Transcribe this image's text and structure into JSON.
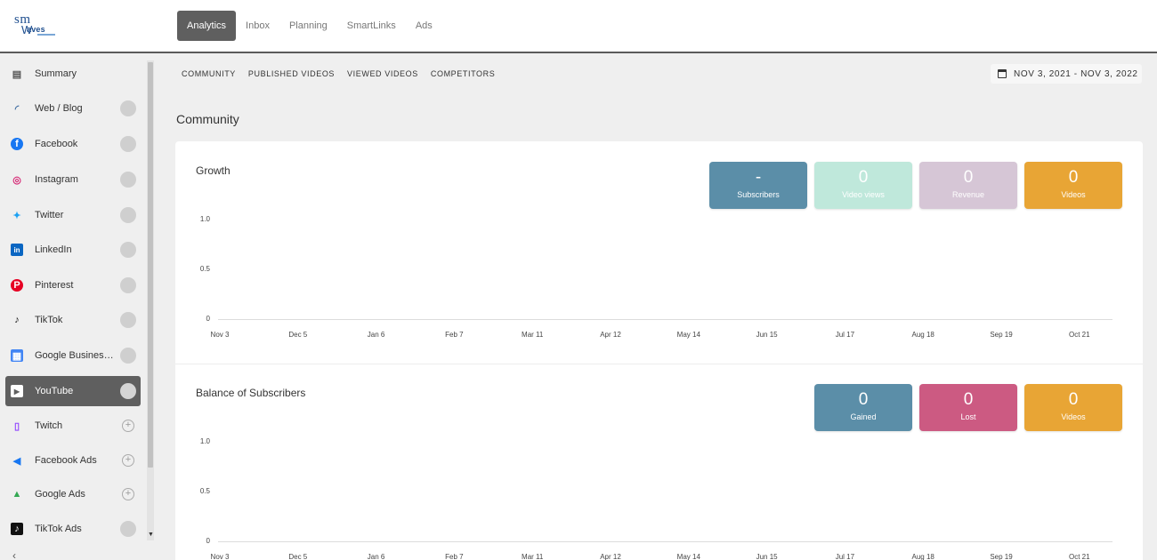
{
  "logo": {
    "text_top": "sm",
    "text_bottom": "aves"
  },
  "nav": {
    "tabs": [
      "Analytics",
      "Inbox",
      "Planning",
      "SmartLinks",
      "Ads"
    ],
    "active": 0
  },
  "sidebar": {
    "items": [
      {
        "label": "Summary",
        "icon": "clipboard-icon",
        "status": "none"
      },
      {
        "label": "Web / Blog",
        "icon": "rss-icon",
        "status": "dot"
      },
      {
        "label": "Facebook",
        "icon": "facebook-icon",
        "status": "dot"
      },
      {
        "label": "Instagram",
        "icon": "instagram-icon",
        "status": "dot"
      },
      {
        "label": "Twitter",
        "icon": "twitter-icon",
        "status": "dot"
      },
      {
        "label": "LinkedIn",
        "icon": "linkedin-icon",
        "status": "dot"
      },
      {
        "label": "Pinterest",
        "icon": "pinterest-icon",
        "status": "dot"
      },
      {
        "label": "TikTok",
        "icon": "tiktok-icon",
        "status": "dot"
      },
      {
        "label": "Google Business Profile",
        "icon": "google-business-icon",
        "status": "dot"
      },
      {
        "label": "YouTube",
        "icon": "youtube-icon",
        "status": "dot"
      },
      {
        "label": "Twitch",
        "icon": "twitch-icon",
        "status": "plus"
      },
      {
        "label": "Facebook Ads",
        "icon": "megaphone-icon",
        "status": "plus"
      },
      {
        "label": "Google Ads",
        "icon": "google-ads-icon",
        "status": "plus"
      },
      {
        "label": "TikTok Ads",
        "icon": "tiktok-ads-icon",
        "status": "dot"
      }
    ],
    "active_index": 9,
    "collapse_glyph": "‹"
  },
  "subnav": {
    "items": [
      "COMMUNITY",
      "PUBLISHED VIDEOS",
      "VIEWED VIDEOS",
      "COMPETITORS"
    ]
  },
  "date_range": "NOV 3, 2021 - NOV 3, 2022",
  "page_title": "Community",
  "growth": {
    "title": "Growth",
    "stats": [
      {
        "value": "-",
        "label": "Subscribers",
        "color": "#5b8ea8"
      },
      {
        "value": "0",
        "label": "Video views",
        "color": "#bfe8db"
      },
      {
        "value": "0",
        "label": "Revenue",
        "color": "#d6c6d6"
      },
      {
        "value": "0",
        "label": "Videos",
        "color": "#e8a535"
      }
    ]
  },
  "balance": {
    "title": "Balance of Subscribers",
    "stats": [
      {
        "value": "0",
        "label": "Gained",
        "color": "#5b8ea8"
      },
      {
        "value": "0",
        "label": "Lost",
        "color": "#cc5a82"
      },
      {
        "value": "0",
        "label": "Videos",
        "color": "#e8a535"
      }
    ]
  },
  "chart_data": [
    {
      "type": "line",
      "title": "Growth",
      "xlabel": "",
      "ylabel": "",
      "categories": [
        "Nov 3",
        "Dec 5",
        "Jan 6",
        "Feb 7",
        "Mar 11",
        "Apr 12",
        "May 14",
        "Jun 15",
        "Jul 17",
        "Aug 18",
        "Sep 19",
        "Oct 21"
      ],
      "yticks": [
        "1.0",
        "0.5",
        "0"
      ],
      "ylim": [
        0,
        1
      ],
      "series": []
    },
    {
      "type": "line",
      "title": "Balance of Subscribers",
      "xlabel": "",
      "ylabel": "",
      "categories": [
        "Nov 3",
        "Dec 5",
        "Jan 6",
        "Feb 7",
        "Mar 11",
        "Apr 12",
        "May 14",
        "Jun 15",
        "Jul 17",
        "Aug 18",
        "Sep 19",
        "Oct 21"
      ],
      "yticks": [
        "1.0",
        "0.5",
        "0"
      ],
      "ylim": [
        0,
        1
      ],
      "series": []
    }
  ]
}
